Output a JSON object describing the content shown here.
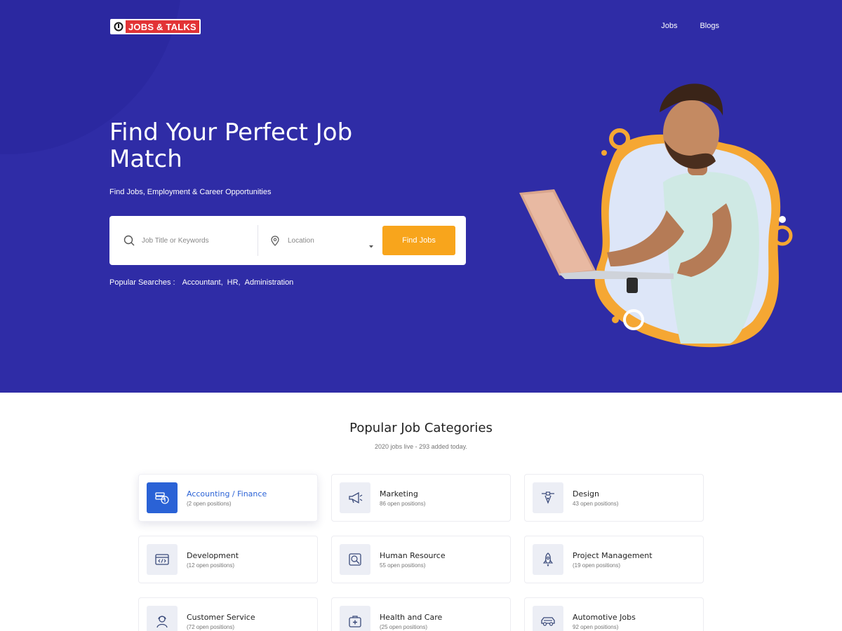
{
  "brand": {
    "logo_text": "JOBS & TALKS"
  },
  "nav": {
    "items": [
      "Jobs",
      "Blogs"
    ]
  },
  "hero": {
    "title": "Find Your Perfect Job Match",
    "subtitle": "Find Jobs, Employment & Career Opportunities",
    "search": {
      "keyword_placeholder": "Job Title or Keywords",
      "location_placeholder": "Location",
      "button_label": "Find Jobs"
    },
    "popular": {
      "label": "Popular Searches :",
      "items": [
        "Accountant,",
        "HR,",
        "Administration"
      ]
    }
  },
  "categories": {
    "title": "Popular Job Categories",
    "subtitle": "2020 jobs live - 293 added today.",
    "items": [
      {
        "name": "Accounting / Finance",
        "count": "(2 open positions)",
        "icon": "finance-icon",
        "active": true
      },
      {
        "name": "Marketing",
        "count": "86 open positions)",
        "icon": "megaphone-icon",
        "active": false
      },
      {
        "name": "Design",
        "count": "43 open positions)",
        "icon": "pen-tool-icon",
        "active": false
      },
      {
        "name": "Development",
        "count": "(12 open positions)",
        "icon": "code-window-icon",
        "active": false
      },
      {
        "name": "Human Resource",
        "count": "55 open positions)",
        "icon": "person-search-icon",
        "active": false
      },
      {
        "name": "Project Management",
        "count": "(19 open positions)",
        "icon": "rocket-icon",
        "active": false
      },
      {
        "name": "Customer Service",
        "count": "(72 open positions)",
        "icon": "headset-agent-icon",
        "active": false
      },
      {
        "name": "Health and Care",
        "count": "(25 open positions)",
        "icon": "medical-kit-icon",
        "active": false
      },
      {
        "name": "Automotive Jobs",
        "count": "92 open positions)",
        "icon": "car-icon",
        "active": false
      }
    ]
  },
  "colors": {
    "hero_bg": "#2f2ca6",
    "accent": "#f8a51c",
    "active_card": "#2a62d6"
  }
}
